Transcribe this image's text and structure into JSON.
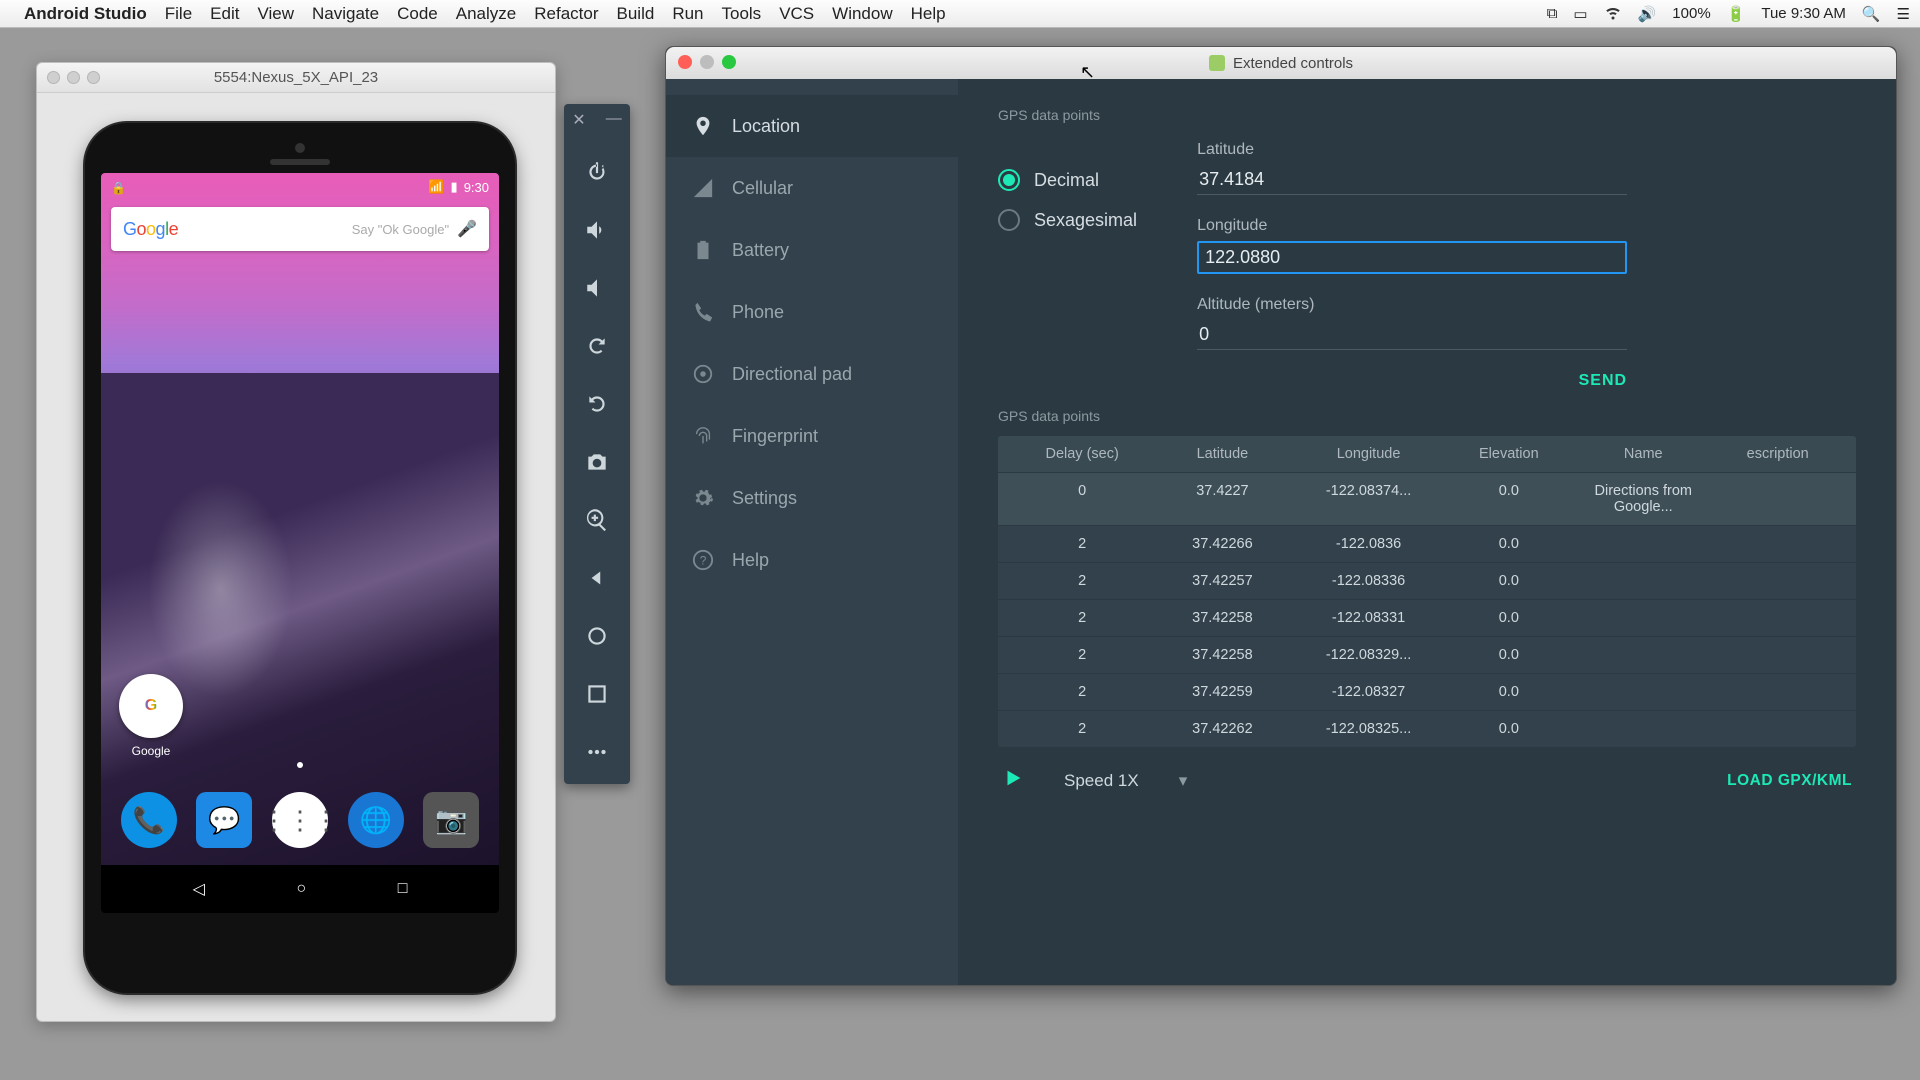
{
  "menubar": {
    "app": "Android Studio",
    "items": [
      "File",
      "Edit",
      "View",
      "Navigate",
      "Code",
      "Analyze",
      "Refactor",
      "Build",
      "Run",
      "Tools",
      "VCS",
      "Window",
      "Help"
    ],
    "battery": "100%",
    "clock": "Tue 9:30 AM"
  },
  "emulator": {
    "title": "5554:Nexus_5X_API_23",
    "status_time": "9:30",
    "search_placeholder": "Say \"Ok Google\"",
    "google_label": "Google"
  },
  "side_tools": [
    "close",
    "minimize",
    "power",
    "volume-up",
    "volume-down",
    "rotate-left",
    "rotate-right",
    "camera",
    "zoom",
    "back",
    "home",
    "overview",
    "more"
  ],
  "ext": {
    "title": "Extended controls",
    "categories": [
      "Location",
      "Cellular",
      "Battery",
      "Phone",
      "Directional pad",
      "Fingerprint",
      "Settings",
      "Help"
    ],
    "active_category": "Location",
    "gps_section": "GPS data points",
    "format": {
      "decimal": "Decimal",
      "sexagesimal": "Sexagesimal",
      "selected": "decimal"
    },
    "fields": {
      "latitude_label": "Latitude",
      "latitude": "37.4184",
      "longitude_label": "Longitude",
      "longitude": "122.0880",
      "altitude_label": "Altitude (meters)",
      "altitude": "0"
    },
    "send": "SEND",
    "table": {
      "headers": [
        "Delay (sec)",
        "Latitude",
        "Longitude",
        "Elevation",
        "Name",
        "escription"
      ],
      "rows": [
        {
          "delay": "0",
          "lat": "37.4227",
          "lon": "-122.08374...",
          "elev": "0.0",
          "name": "Directions from Google...",
          "desc": ""
        },
        {
          "delay": "2",
          "lat": "37.42266",
          "lon": "-122.0836",
          "elev": "0.0",
          "name": "",
          "desc": ""
        },
        {
          "delay": "2",
          "lat": "37.42257",
          "lon": "-122.08336",
          "elev": "0.0",
          "name": "",
          "desc": ""
        },
        {
          "delay": "2",
          "lat": "37.42258",
          "lon": "-122.08331",
          "elev": "0.0",
          "name": "",
          "desc": ""
        },
        {
          "delay": "2",
          "lat": "37.42258",
          "lon": "-122.08329...",
          "elev": "0.0",
          "name": "",
          "desc": ""
        },
        {
          "delay": "2",
          "lat": "37.42259",
          "lon": "-122.08327",
          "elev": "0.0",
          "name": "",
          "desc": ""
        },
        {
          "delay": "2",
          "lat": "37.42262",
          "lon": "-122.08325...",
          "elev": "0.0",
          "name": "",
          "desc": ""
        }
      ]
    },
    "speed": "Speed 1X",
    "load": "LOAD GPX/KML"
  }
}
